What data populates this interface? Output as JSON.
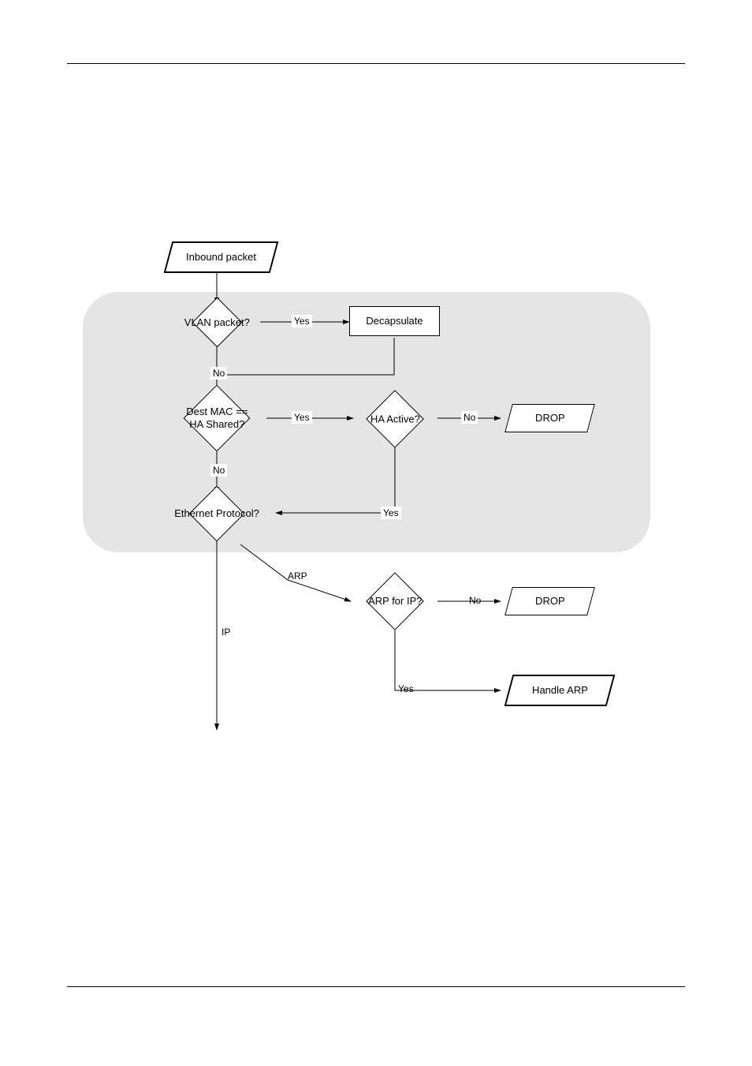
{
  "flowchart": {
    "inbound": "Inbound packet",
    "vlan": "VLAN packet?",
    "decapsulate": "Decapsulate",
    "destmac": "Dest MAC ==\nHA Shared?",
    "ha_active": "HA Active?",
    "drop1": "DROP",
    "ethernet": "Ethernet Protocol?",
    "arp_for_ip": "ARP for IP?",
    "drop2": "DROP",
    "handle_arp": "Handle ARP"
  },
  "labels": {
    "yes": "Yes",
    "no": "No",
    "arp": "ARP",
    "ip": "IP"
  }
}
